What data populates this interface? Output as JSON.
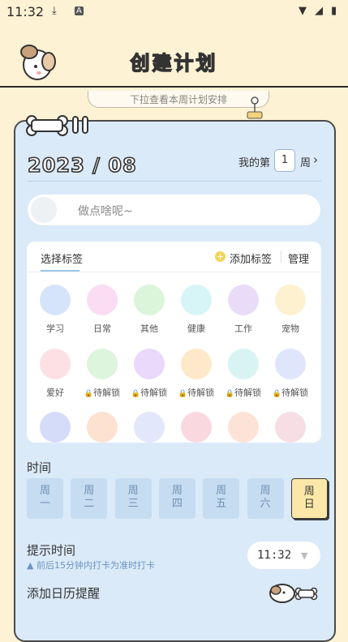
{
  "status": {
    "time": "11:32"
  },
  "header": {
    "title": "创建计划",
    "week_hint": "下拉查看本周计划安排"
  },
  "plan": {
    "month": "2023 / 08",
    "week_prefix": "我的第",
    "week_number": "1",
    "week_suffix": "周",
    "task_placeholder": "做点啥呢~"
  },
  "tags": {
    "title": "选择标签",
    "add_label": "添加标签",
    "manage_label": "管理",
    "items": [
      {
        "label": "学习",
        "color": "#d6e4fb",
        "icon": "clock-icon"
      },
      {
        "label": "日常",
        "color": "#fadcf3",
        "icon": "flower-icon"
      },
      {
        "label": "其他",
        "color": "#daf5d9",
        "icon": "sparkle-icon"
      },
      {
        "label": "健康",
        "color": "#d7f5f6",
        "icon": "pill-icon"
      },
      {
        "label": "工作",
        "color": "#eadcf8",
        "icon": "folder-icon"
      },
      {
        "label": "宠物",
        "color": "#fdf1cf",
        "icon": "paw-icon"
      },
      {
        "label": "爱好",
        "color": "#fde0e4",
        "icon": "heart-icon"
      },
      {
        "label": "待解锁",
        "color": "#dcf5dc",
        "icon": "luggage-icon"
      },
      {
        "label": "待解锁",
        "color": "#ead9fa",
        "icon": "lipstick-icon"
      },
      {
        "label": "待解锁",
        "color": "#fde9c9",
        "icon": "teapot-icon"
      },
      {
        "label": "待解锁",
        "color": "#d8f3f3",
        "icon": "apple-icon"
      },
      {
        "label": "待解锁",
        "color": "#dfe6fb",
        "icon": "bottle-icon"
      }
    ]
  },
  "time": {
    "title": "时间",
    "days": [
      {
        "top": "周",
        "bottom": "一",
        "active": false
      },
      {
        "top": "周",
        "bottom": "二",
        "active": false
      },
      {
        "top": "周",
        "bottom": "三",
        "active": false
      },
      {
        "top": "周",
        "bottom": "四",
        "active": false
      },
      {
        "top": "周",
        "bottom": "五",
        "active": false
      },
      {
        "top": "周",
        "bottom": "六",
        "active": false
      },
      {
        "top": "周",
        "bottom": "日",
        "active": true
      }
    ]
  },
  "reminder": {
    "title": "提示时间",
    "hint": "前后15分钟内打卡为准时打卡",
    "time": "11:32"
  },
  "calendar": {
    "title": "添加日历提醒"
  }
}
